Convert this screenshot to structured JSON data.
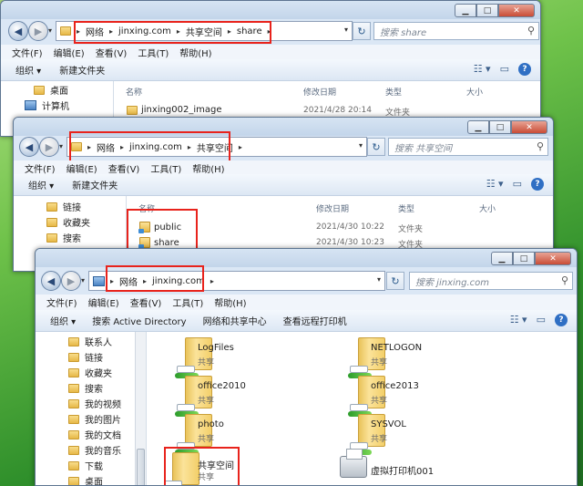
{
  "windows": {
    "share": {
      "breadcrumb": [
        "网络",
        "jinxing.com",
        "共享空间",
        "share"
      ],
      "search_placeholder": "搜索 share",
      "menu": [
        "文件(F)",
        "编辑(E)",
        "查看(V)",
        "工具(T)",
        "帮助(H)"
      ],
      "toolbar": {
        "organize": "组织 ▾",
        "new_folder": "新建文件夹"
      },
      "nav_items": [
        "桌面",
        "计算机"
      ],
      "columns": {
        "name": "名称",
        "modified": "修改日期",
        "type": "类型",
        "size": "大小"
      },
      "files": [
        {
          "name": "jinxing002_image",
          "modified": "2021/4/28 20:14",
          "type": "文件夹"
        }
      ]
    },
    "shared_space": {
      "breadcrumb": [
        "网络",
        "jinxing.com",
        "共享空间"
      ],
      "search_placeholder": "搜索 共享空间",
      "menu": [
        "文件(F)",
        "编辑(E)",
        "查看(V)",
        "工具(T)",
        "帮助(H)"
      ],
      "toolbar": {
        "organize": "组织 ▾",
        "new_folder": "新建文件夹"
      },
      "nav_items": [
        "链接",
        "收藏夹",
        "搜索"
      ],
      "columns": {
        "name": "名称",
        "modified": "修改日期",
        "type": "类型",
        "size": "大小"
      },
      "files": [
        {
          "name": "public",
          "modified": "2021/4/30 10:22",
          "type": "文件夹"
        },
        {
          "name": "share",
          "modified": "2021/4/30 10:23",
          "type": "文件夹"
        }
      ]
    },
    "server": {
      "breadcrumb": [
        "网络",
        "jinxing.com"
      ],
      "search_placeholder": "搜索 jinxing.com",
      "menu": [
        "文件(F)",
        "编辑(E)",
        "查看(V)",
        "工具(T)",
        "帮助(H)"
      ],
      "toolbar": {
        "organize": "组织 ▾",
        "search_ad": "搜索 Active Directory",
        "network_center": "网络和共享中心",
        "view_printers": "查看远程打印机"
      },
      "nav_items": [
        "联系人",
        "链接",
        "收藏夹",
        "搜索",
        "我的视频",
        "我的图片",
        "我的文档",
        "我的音乐",
        "下载",
        "桌面"
      ],
      "shares": [
        {
          "name": "LogFiles",
          "sub": "共享"
        },
        {
          "name": "NETLOGON",
          "sub": "共享"
        },
        {
          "name": "office2010",
          "sub": "共享"
        },
        {
          "name": "office2013",
          "sub": "共享"
        },
        {
          "name": "photo",
          "sub": "共享"
        },
        {
          "name": "SYSVOL",
          "sub": "共享"
        },
        {
          "name": "共享空间",
          "sub": "共享"
        },
        {
          "name": "虚拟打印机001",
          "sub": ""
        }
      ]
    }
  },
  "icons": {
    "back": "back-arrow-icon",
    "forward": "forward-arrow-icon",
    "search": "magnifier-icon",
    "help": "help-icon"
  }
}
